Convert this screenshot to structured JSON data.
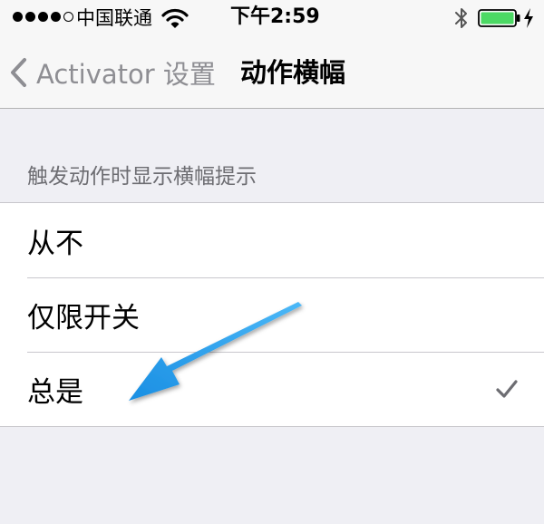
{
  "status_bar": {
    "signal_dots": [
      "full",
      "full",
      "full",
      "full",
      "empty"
    ],
    "carrier": "中国联通",
    "wifi_icon": "wifi-icon",
    "time": "下午2:59",
    "bluetooth_icon": "bluetooth-icon",
    "battery_icon": "battery-icon",
    "battery_level": 1.0,
    "charging_icon": "charging-bolt-icon"
  },
  "nav": {
    "back_label": "Activator 设置",
    "back_icon": "chevron-left-icon",
    "title": "动作横幅"
  },
  "section": {
    "header": "触发动作时显示横幅提示",
    "options": [
      {
        "label": "从不",
        "selected": false
      },
      {
        "label": "仅限开关",
        "selected": false
      },
      {
        "label": "总是",
        "selected": true
      }
    ],
    "check_icon": "checkmark-icon"
  },
  "annotation": {
    "icon": "arrow-icon",
    "color": "#1e9ff0",
    "points_to": "总是"
  },
  "colors": {
    "background": "#efeff4",
    "nav_background": "#f7f7f7",
    "secondary_text": "#8e8e93",
    "section_header_text": "#6d6d72",
    "battery_green": "#4cd964",
    "checkmark": "#6d6d72"
  }
}
